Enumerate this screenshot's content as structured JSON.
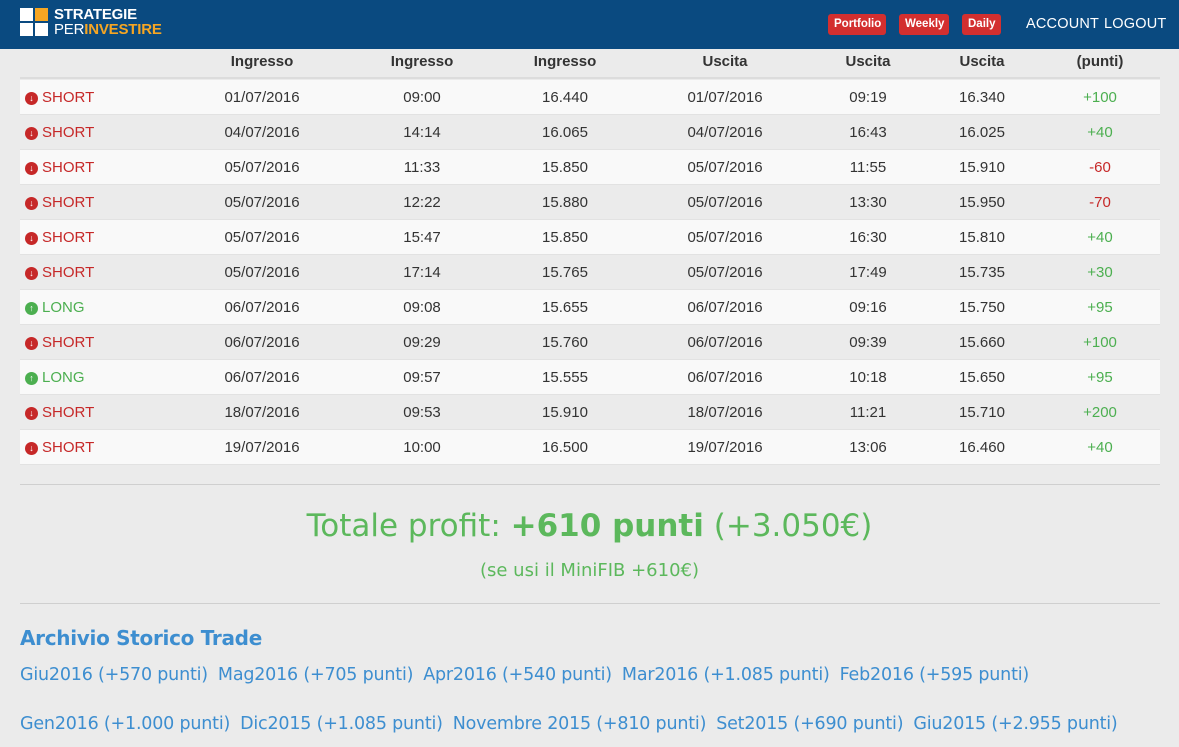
{
  "header": {
    "logo_line1": "STRATEGIE",
    "logo_per": "PER",
    "logo_investire": "INVESTIRE",
    "badges": [
      "Portfolio",
      "Weekly",
      "Daily"
    ],
    "nav": [
      "ACCOUNT",
      "LOGOUT"
    ],
    "colors": {
      "bar": "#0a4a80",
      "badge": "#d32f2f",
      "accent": "#f6a623"
    }
  },
  "table": {
    "columns": [
      "",
      "Ingresso",
      "Ingresso",
      "Ingresso",
      "Uscita",
      "Uscita",
      "Uscita",
      "(punti)"
    ],
    "rows": [
      {
        "type": "SHORT",
        "date_in": "01/07/2016",
        "time_in": "09:00",
        "price_in": "16.440",
        "date_out": "01/07/2016",
        "time_out": "09:19",
        "price_out": "16.340",
        "points": "+100"
      },
      {
        "type": "SHORT",
        "date_in": "04/07/2016",
        "time_in": "14:14",
        "price_in": "16.065",
        "date_out": "04/07/2016",
        "time_out": "16:43",
        "price_out": "16.025",
        "points": "+40"
      },
      {
        "type": "SHORT",
        "date_in": "05/07/2016",
        "time_in": "11:33",
        "price_in": "15.850",
        "date_out": "05/07/2016",
        "time_out": "11:55",
        "price_out": "15.910",
        "points": "-60"
      },
      {
        "type": "SHORT",
        "date_in": "05/07/2016",
        "time_in": "12:22",
        "price_in": "15.880",
        "date_out": "05/07/2016",
        "time_out": "13:30",
        "price_out": "15.950",
        "points": "-70"
      },
      {
        "type": "SHORT",
        "date_in": "05/07/2016",
        "time_in": "15:47",
        "price_in": "15.850",
        "date_out": "05/07/2016",
        "time_out": "16:30",
        "price_out": "15.810",
        "points": "+40"
      },
      {
        "type": "SHORT",
        "date_in": "05/07/2016",
        "time_in": "17:14",
        "price_in": "15.765",
        "date_out": "05/07/2016",
        "time_out": "17:49",
        "price_out": "15.735",
        "points": "+30"
      },
      {
        "type": "LONG",
        "date_in": "06/07/2016",
        "time_in": "09:08",
        "price_in": "15.655",
        "date_out": "06/07/2016",
        "time_out": "09:16",
        "price_out": "15.750",
        "points": "+95"
      },
      {
        "type": "SHORT",
        "date_in": "06/07/2016",
        "time_in": "09:29",
        "price_in": "15.760",
        "date_out": "06/07/2016",
        "time_out": "09:39",
        "price_out": "15.660",
        "points": "+100"
      },
      {
        "type": "LONG",
        "date_in": "06/07/2016",
        "time_in": "09:57",
        "price_in": "15.555",
        "date_out": "06/07/2016",
        "time_out": "10:18",
        "price_out": "15.650",
        "points": "+95"
      },
      {
        "type": "SHORT",
        "date_in": "18/07/2016",
        "time_in": "09:53",
        "price_in": "15.910",
        "date_out": "18/07/2016",
        "time_out": "11:21",
        "price_out": "15.710",
        "points": "+200"
      },
      {
        "type": "SHORT",
        "date_in": "19/07/2016",
        "time_in": "10:00",
        "price_in": "16.500",
        "date_out": "19/07/2016",
        "time_out": "13:06",
        "price_out": "16.460",
        "points": "+40"
      }
    ],
    "colors": {
      "short": "#c62828",
      "long": "#4caf50"
    }
  },
  "summary": {
    "label": "Totale profit: ",
    "points": "+610 punti",
    "euro": " (+3.050€)",
    "minifib": "(se usi il MiniFIB +610€)",
    "color": "#5cb85c"
  },
  "archive": {
    "title": "Archivio Storico Trade",
    "row1": [
      "Giu2016 (+570 punti)",
      "Mag2016 (+705 punti)",
      "Apr2016 (+540 punti)",
      "Mar2016 (+1.085 punti)",
      "Feb2016 (+595 punti)"
    ],
    "row2": [
      "Gen2016 (+1.000 punti)",
      "Dic2015 (+1.085 punti)",
      "Novembre 2015 (+810 punti)",
      "Set2015 (+690 punti)",
      "Giu2015 (+2.955 punti)"
    ],
    "color": "#3d8ed0"
  }
}
